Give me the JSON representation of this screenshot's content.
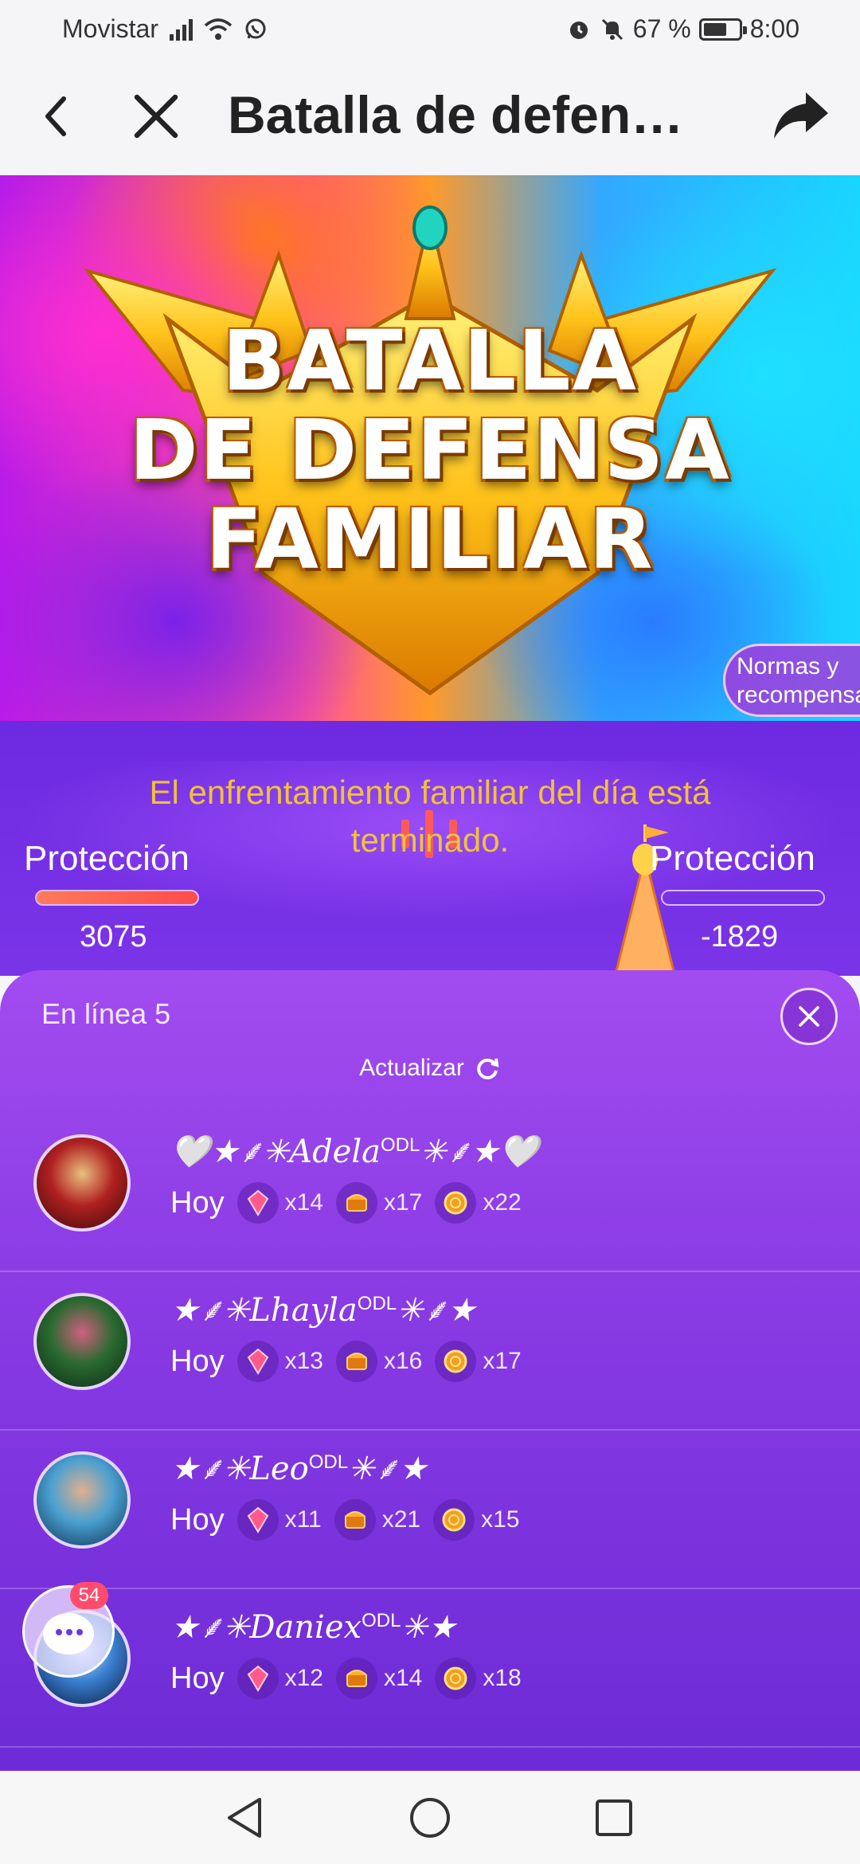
{
  "status_bar": {
    "carrier": "Movistar",
    "battery_percent": "67 %",
    "battery_level": 0.67,
    "time": "8:00",
    "icons": [
      "signal-icon",
      "wifi-icon",
      "whatsapp-icon",
      "alarm-icon",
      "mute-icon",
      "battery-icon"
    ]
  },
  "app_bar": {
    "title": "Batalla de defen…",
    "icons": [
      "back-arrow-icon",
      "close-icon",
      "share-icon"
    ]
  },
  "banner": {
    "title_line1": "BATALLA",
    "title_line2": "DE DEFENSA",
    "title_line3": "FAMILIAR",
    "rules_button": "Normas y recompensa"
  },
  "battle": {
    "ended_message": "El enfrentamiento familiar del día está terminado.",
    "left": {
      "label": "Protección",
      "score": "3075"
    },
    "right": {
      "label": "Protección",
      "score": "-1829"
    }
  },
  "online_sheet": {
    "title": "En línea 5",
    "refresh_label": "Actualizar",
    "members": [
      {
        "name": "🤍★⸙✳Adela",
        "tag": "ODL",
        "suffix": "✳⸙★🤍",
        "when": "Hoy",
        "stats": [
          "x14",
          "x17",
          "x22"
        ]
      },
      {
        "name": "★⸙✳Lhayla",
        "tag": "ODL",
        "suffix": "✳⸙★",
        "when": "Hoy",
        "stats": [
          "x13",
          "x16",
          "x17"
        ]
      },
      {
        "name": "★⸙✳Leo",
        "tag": "ODL",
        "suffix": "✳⸙★",
        "when": "Hoy",
        "stats": [
          "x11",
          "x21",
          "x15"
        ]
      },
      {
        "name": "★⸙✳Daniex",
        "tag": "ODL",
        "suffix": "✳★",
        "when": "Hoy",
        "stats": [
          "x12",
          "x14",
          "x18"
        ]
      }
    ],
    "stat_icons": [
      "crystal-gem-icon",
      "treasure-chest-icon",
      "gold-coin-icon"
    ],
    "chat_badge": "54"
  },
  "nav_bar": {
    "icons": [
      "nav-back-icon",
      "nav-home-icon",
      "nav-recents-icon"
    ]
  }
}
